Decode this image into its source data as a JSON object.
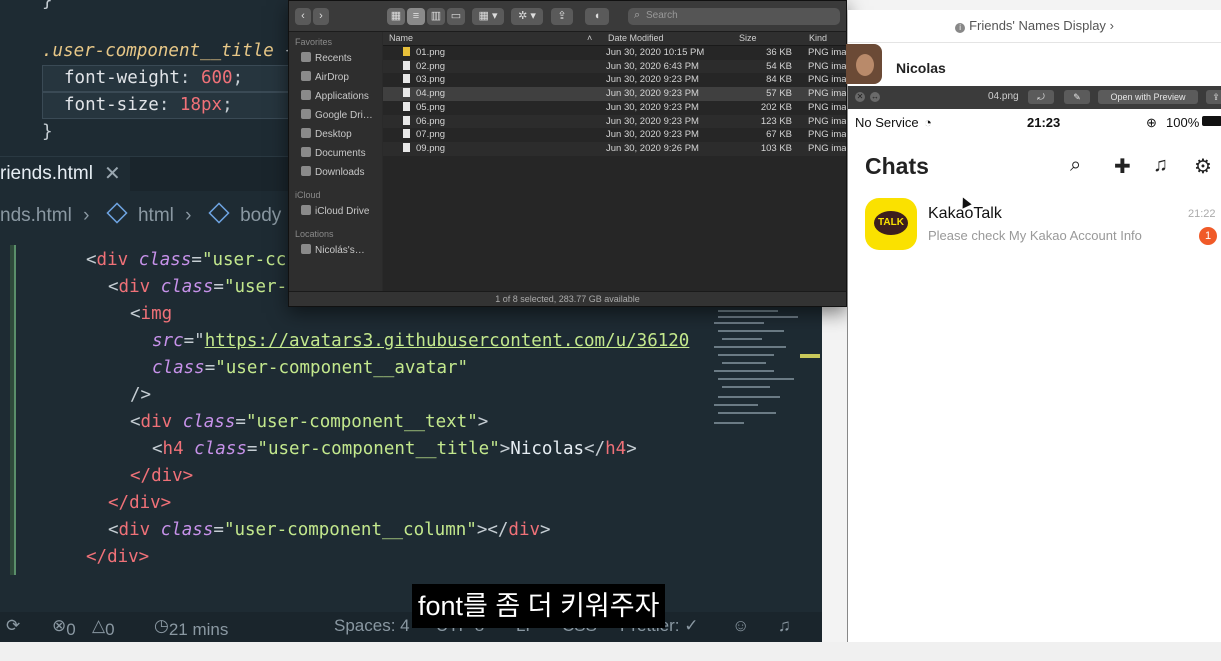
{
  "editor": {
    "css_lines": [
      {
        "selector": ".user-component__title",
        "brace": " {"
      },
      {
        "prop": "font-weight",
        "value": "600"
      },
      {
        "prop": "font-size",
        "value": "18px"
      }
    ],
    "closing_brace": "}",
    "tab_name": "riends.html",
    "tab_close": "✕",
    "breadcrumb": [
      "nds.html",
      "html",
      "body"
    ],
    "html_lines": {
      "l1_class": "\"user-cc",
      "l2_class": "\"user-",
      "img_tag": "img",
      "src_attr": "src",
      "src_value": "https://avatars3.githubusercontent.com/u/36120",
      "class_attr": "class",
      "avatar_class": "\"user-component__avatar\"",
      "self_close": "/>",
      "text_div_class": "\"user-component__text\"",
      "h4_class": "\"user-component__title\"",
      "h4_text": "Nicolas",
      "div_close": "</div>",
      "column_class": "\"user-component__column\""
    },
    "status": {
      "errors": "0",
      "warnings": "0",
      "time": "21 mins",
      "spaces": "Spaces: 4",
      "encoding": "UTF-8",
      "eol": "LF",
      "lang": "CSS",
      "formatter": "Prettier: ✓"
    }
  },
  "finder": {
    "search_placeholder": "Search",
    "sidebar": {
      "favorites_label": "Favorites",
      "favorites": [
        "Recents",
        "AirDrop",
        "Applications",
        "Google Dri…",
        "Desktop",
        "Documents",
        "Downloads"
      ],
      "icloud_label": "iCloud",
      "icloud": [
        "iCloud Drive"
      ],
      "locations_label": "Locations",
      "locations": [
        "Nicolás's…"
      ]
    },
    "columns": {
      "name": "Name",
      "date": "Date Modified",
      "size": "Size",
      "kind": "Kind"
    },
    "files": [
      {
        "name": "01.png",
        "date": "Jun 30, 2020 10:15 PM",
        "size": "36 KB",
        "kind": "PNG imag"
      },
      {
        "name": "02.png",
        "date": "Jun 30, 2020 6:43 PM",
        "size": "54 KB",
        "kind": "PNG imag"
      },
      {
        "name": "03.png",
        "date": "Jun 30, 2020 9:23 PM",
        "size": "84 KB",
        "kind": "PNG imag"
      },
      {
        "name": "04.png",
        "date": "Jun 30, 2020 9:23 PM",
        "size": "57 KB",
        "kind": "PNG imag"
      },
      {
        "name": "05.png",
        "date": "Jun 30, 2020 9:23 PM",
        "size": "202 KB",
        "kind": "PNG imag"
      },
      {
        "name": "06.png",
        "date": "Jun 30, 2020 9:23 PM",
        "size": "123 KB",
        "kind": "PNG imag"
      },
      {
        "name": "07.png",
        "date": "Jun 30, 2020 9:23 PM",
        "size": "67 KB",
        "kind": "PNG imag"
      },
      {
        "name": "09.png",
        "date": "Jun 30, 2020 9:26 PM",
        "size": "103 KB",
        "kind": "PNG imag"
      }
    ],
    "status": "1 of 8 selected, 283.77 GB available"
  },
  "simulator": {
    "title": "Friends' Names Display",
    "title_chevron": "›",
    "contact_name": "Nicolas"
  },
  "preview": {
    "file_name": "04.png",
    "open_with": "Open with Preview",
    "phone": {
      "carrier": "No Service",
      "time": "21:23",
      "battery": "100%"
    },
    "chats_title": "Chats",
    "chat": {
      "name": "KakaoTalk",
      "preview": "Please check My Kakao Account Info",
      "time": "21:22",
      "badge": "1",
      "logo_text": "TALK"
    }
  },
  "subtitle": "font를 좀 더 키워주자"
}
